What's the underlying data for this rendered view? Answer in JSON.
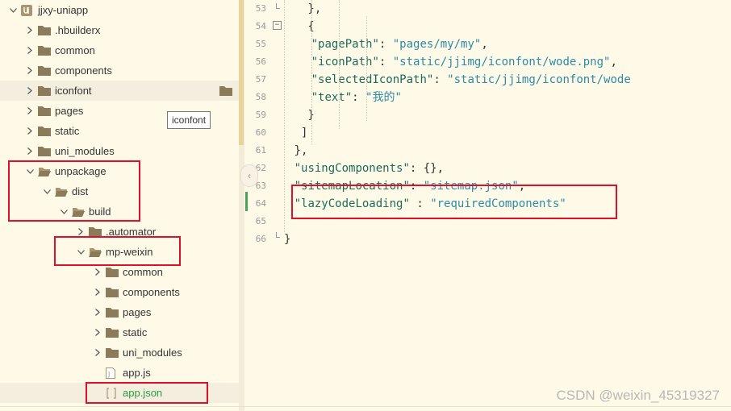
{
  "explorer": {
    "tooltip": "iconfont",
    "items": [
      {
        "label": "jjxy-uniapp",
        "type": "project",
        "expanded": true
      },
      {
        "label": ".hbuilderx",
        "type": "folder",
        "expanded": false
      },
      {
        "label": "common",
        "type": "folder",
        "expanded": false
      },
      {
        "label": "components",
        "type": "folder",
        "expanded": false
      },
      {
        "label": "iconfont",
        "type": "folder",
        "expanded": false
      },
      {
        "label": "pages",
        "type": "folder",
        "expanded": false
      },
      {
        "label": "static",
        "type": "folder",
        "expanded": false
      },
      {
        "label": "uni_modules",
        "type": "folder",
        "expanded": false
      },
      {
        "label": "unpackage",
        "type": "folder",
        "expanded": true
      },
      {
        "label": "dist",
        "type": "folder",
        "expanded": true
      },
      {
        "label": "build",
        "type": "folder",
        "expanded": true
      },
      {
        "label": ".automator",
        "type": "folder",
        "expanded": false
      },
      {
        "label": "mp-weixin",
        "type": "folder",
        "expanded": true
      },
      {
        "label": "common",
        "type": "folder",
        "expanded": false
      },
      {
        "label": "components",
        "type": "folder",
        "expanded": false
      },
      {
        "label": "pages",
        "type": "folder",
        "expanded": false
      },
      {
        "label": "static",
        "type": "folder",
        "expanded": false
      },
      {
        "label": "uni_modules",
        "type": "folder",
        "expanded": false
      },
      {
        "label": "app.js",
        "type": "js-file"
      },
      {
        "label": "app.json",
        "type": "json-file"
      }
    ]
  },
  "editor": {
    "line_numbers": [
      "53",
      "54",
      "55",
      "56",
      "57",
      "58",
      "59",
      "60",
      "61",
      "62",
      "63",
      "64",
      "65",
      "66"
    ],
    "lines": [
      [
        {
          "t": "},",
          "c": "p"
        }
      ],
      [
        {
          "t": "{",
          "c": "p"
        }
      ],
      [
        {
          "t": "\"pagePath\"",
          "c": "k"
        },
        {
          "t": ": ",
          "c": "p"
        },
        {
          "t": "\"pages/my/my\"",
          "c": "s"
        },
        {
          "t": ",",
          "c": "p"
        }
      ],
      [
        {
          "t": "\"iconPath\"",
          "c": "k"
        },
        {
          "t": ": ",
          "c": "p"
        },
        {
          "t": "\"static/jjimg/iconfont/wode.png\"",
          "c": "s"
        },
        {
          "t": ",",
          "c": "p"
        }
      ],
      [
        {
          "t": "\"selectedIconPath\"",
          "c": "k"
        },
        {
          "t": ": ",
          "c": "p"
        },
        {
          "t": "\"static/jjimg/iconfont/wode",
          "c": "s"
        }
      ],
      [
        {
          "t": "\"text\"",
          "c": "k"
        },
        {
          "t": ": ",
          "c": "p"
        },
        {
          "t": "\"我的\"",
          "c": "s"
        }
      ],
      [
        {
          "t": "}",
          "c": "p"
        }
      ],
      [
        {
          "t": "]",
          "c": "p"
        }
      ],
      [
        {
          "t": "},",
          "c": "p"
        }
      ],
      [
        {
          "t": "\"usingComponents\"",
          "c": "k"
        },
        {
          "t": ": {},",
          "c": "p"
        }
      ],
      [
        {
          "t": "\"sitemapLocation\"",
          "c": "k"
        },
        {
          "t": ": ",
          "c": "p"
        },
        {
          "t": "\"sitemap.json\"",
          "c": "s"
        },
        {
          "t": ",",
          "c": "p"
        }
      ],
      [
        {
          "t": "\"lazyCodeLoading\"",
          "c": "k"
        },
        {
          "t": " : ",
          "c": "p"
        },
        {
          "t": "\"requiredComponents\"",
          "c": "s"
        }
      ],
      [],
      [
        {
          "t": "}",
          "c": "p"
        }
      ]
    ],
    "fold_marker": "−"
  },
  "watermark": "CSDN @weixin_45319327",
  "colors": {
    "annotation_red": "#e0102a",
    "key_color": "#1a6b5b",
    "string_color": "#2a8ba8",
    "folder_color": "#8c7b5b"
  }
}
